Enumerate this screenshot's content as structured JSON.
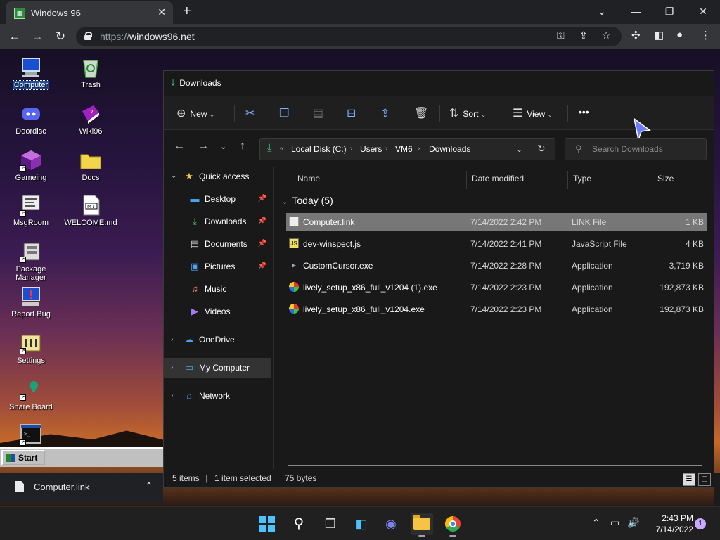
{
  "browser": {
    "tab_title": "Windows 96",
    "url_protocol": "https://",
    "url_host": "windows96.net",
    "window_controls": [
      "⌄",
      "—",
      "❐",
      "✕"
    ]
  },
  "desktop": {
    "icons": [
      {
        "label": "Computer",
        "icon": "computer-icon"
      },
      {
        "label": "Trash",
        "icon": "trash-icon"
      },
      {
        "label": "Doordisc",
        "icon": "discord-icon"
      },
      {
        "label": "Wiki96",
        "icon": "wiki-book-icon"
      },
      {
        "label": "Gameing",
        "icon": "cube-icon"
      },
      {
        "label": "Docs",
        "icon": "folder-icon"
      },
      {
        "label": "MsgRoom",
        "icon": "chat-icon"
      },
      {
        "label": "WELCOME.md",
        "icon": "markdown-file-icon"
      },
      {
        "label": "Package Manager",
        "icon": "package-icon"
      },
      {
        "label": "Report Bug",
        "icon": "bug-report-icon"
      },
      {
        "label": "Settings",
        "icon": "settings-icon"
      },
      {
        "label": "Share Board",
        "icon": "share-board-icon"
      },
      {
        "label": "",
        "icon": "terminal-icon"
      }
    ],
    "start_label": "Start"
  },
  "explorer": {
    "title": "Downloads",
    "commands": {
      "new": "New",
      "sort": "Sort",
      "view": "View",
      "more": "•••"
    },
    "breadcrumb": [
      "Local Disk (C:)",
      "Users",
      "VM6",
      "Downloads"
    ],
    "search_placeholder": "Search Downloads",
    "nav": {
      "quick_access": "Quick access",
      "desktop": "Desktop",
      "downloads": "Downloads",
      "documents": "Documents",
      "pictures": "Pictures",
      "music": "Music",
      "videos": "Videos",
      "onedrive": "OneDrive",
      "my_computer": "My Computer",
      "network": "Network"
    },
    "columns": {
      "name": "Name",
      "date": "Date modified",
      "type": "Type",
      "size": "Size"
    },
    "group": "Today (5)",
    "files": [
      {
        "name": "Computer.link",
        "date": "7/14/2022 2:42 PM",
        "type": "LINK File",
        "size": "1 KB",
        "icon": "link-file-icon",
        "selected": true
      },
      {
        "name": "dev-winspect.js",
        "date": "7/14/2022 2:41 PM",
        "type": "JavaScript File",
        "size": "4 KB",
        "icon": "js-file-icon",
        "selected": false
      },
      {
        "name": "CustomCursor.exe",
        "date": "7/14/2022 2:28 PM",
        "type": "Application",
        "size": "3,719 KB",
        "icon": "app-icon",
        "selected": false
      },
      {
        "name": "lively_setup_x86_full_v1204 (1).exe",
        "date": "7/14/2022 2:23 PM",
        "type": "Application",
        "size": "192,873 KB",
        "icon": "lively-icon",
        "selected": false
      },
      {
        "name": "lively_setup_x86_full_v1204.exe",
        "date": "7/14/2022 2:23 PM",
        "type": "Application",
        "size": "192,873 KB",
        "icon": "lively-icon",
        "selected": false
      }
    ],
    "status": {
      "items": "5 items",
      "selected": "1 item selected",
      "bytes": "75 bytes"
    }
  },
  "download_bar": {
    "file": "Computer.link"
  },
  "taskbar": {
    "time": "2:43 PM",
    "date": "7/14/2022",
    "notifications": "1"
  }
}
